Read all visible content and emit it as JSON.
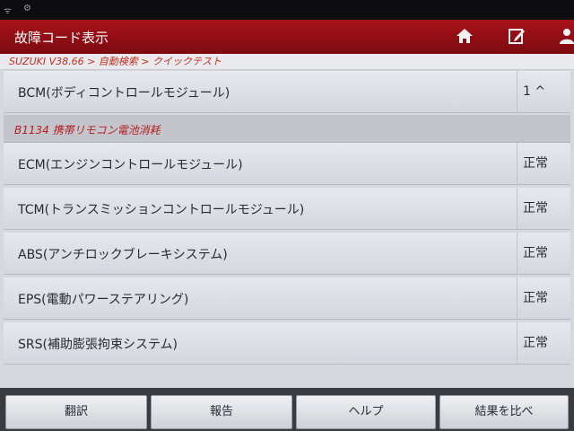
{
  "app": {
    "title": "故障コード表示",
    "breadcrumb": "SUZUKI V38.66 > 自動検索 > クイックテスト"
  },
  "toolbar": {
    "icons": [
      "home-icon",
      "edit-icon",
      "user-icon"
    ]
  },
  "modules": [
    {
      "name": "BCM(ボディコントロールモジュール)",
      "status": "1 ^"
    },
    {
      "name": "ECM(エンジンコントロールモジュール)",
      "status": "正常"
    },
    {
      "name": "TCM(トランスミッションコントロールモジュール)",
      "status": "正常"
    },
    {
      "name": "ABS(アンチロックブレーキシステム)",
      "status": "正常"
    },
    {
      "name": "EPS(電動パワーステアリング)",
      "status": "正常"
    },
    {
      "name": "SRS(補助膨張拘束システム)",
      "status": "正常"
    }
  ],
  "dtc": {
    "text": "B1134 携帯リモコン電池消耗"
  },
  "buttons": {
    "translate": "翻訳",
    "report": "報告",
    "help": "ヘルプ",
    "compare": "結果を比べ"
  },
  "colors": {
    "titlebar": "#a8121a",
    "dtc_text": "#b41e1e",
    "breadcrumb_text": "#c0301e"
  }
}
